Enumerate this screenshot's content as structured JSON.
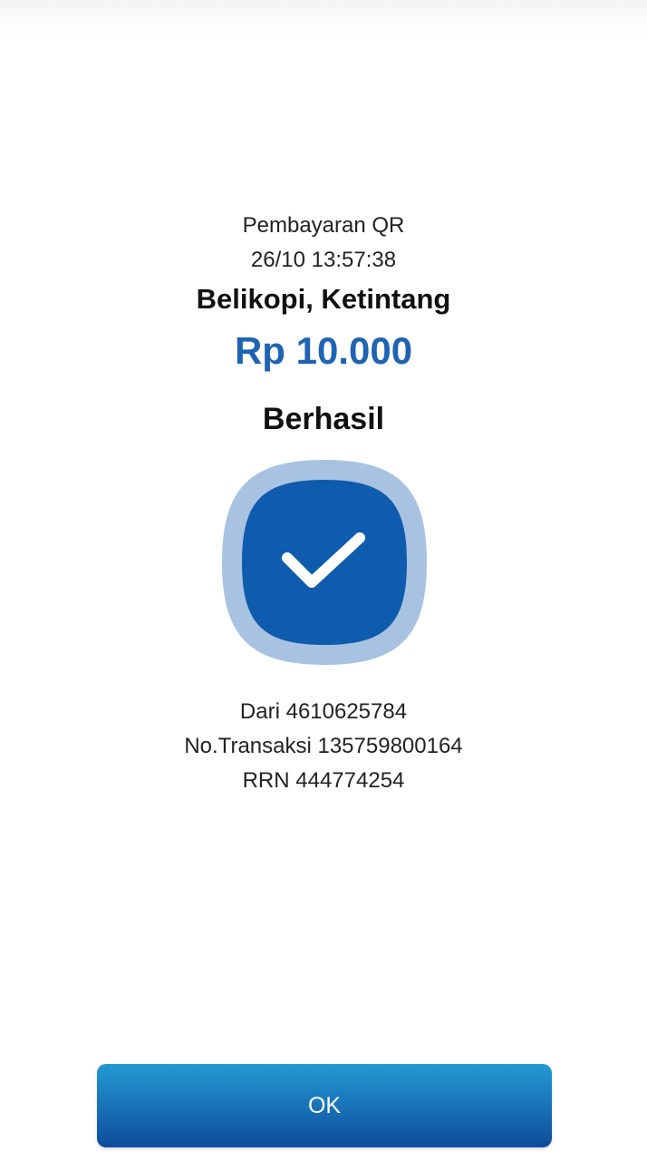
{
  "colors": {
    "accent": "#1f63b3",
    "icon_outer": "#a8c2e2",
    "icon_inner": "#0f5bad",
    "button_top": "#249ad2",
    "button_bottom": "#0d4c9c"
  },
  "receipt": {
    "payment_type": "Pembayaran QR",
    "date_time": "26/10 13:57:38",
    "merchant": "Belikopi, Ketintang",
    "amount": "Rp 10.000",
    "status": "Berhasil",
    "status_icon": "checkmark-icon",
    "from": "Dari 4610625784",
    "transaction_no": "No.Transaksi 135759800164",
    "rrn": "RRN 444774254"
  },
  "actions": {
    "ok_label": "OK"
  }
}
